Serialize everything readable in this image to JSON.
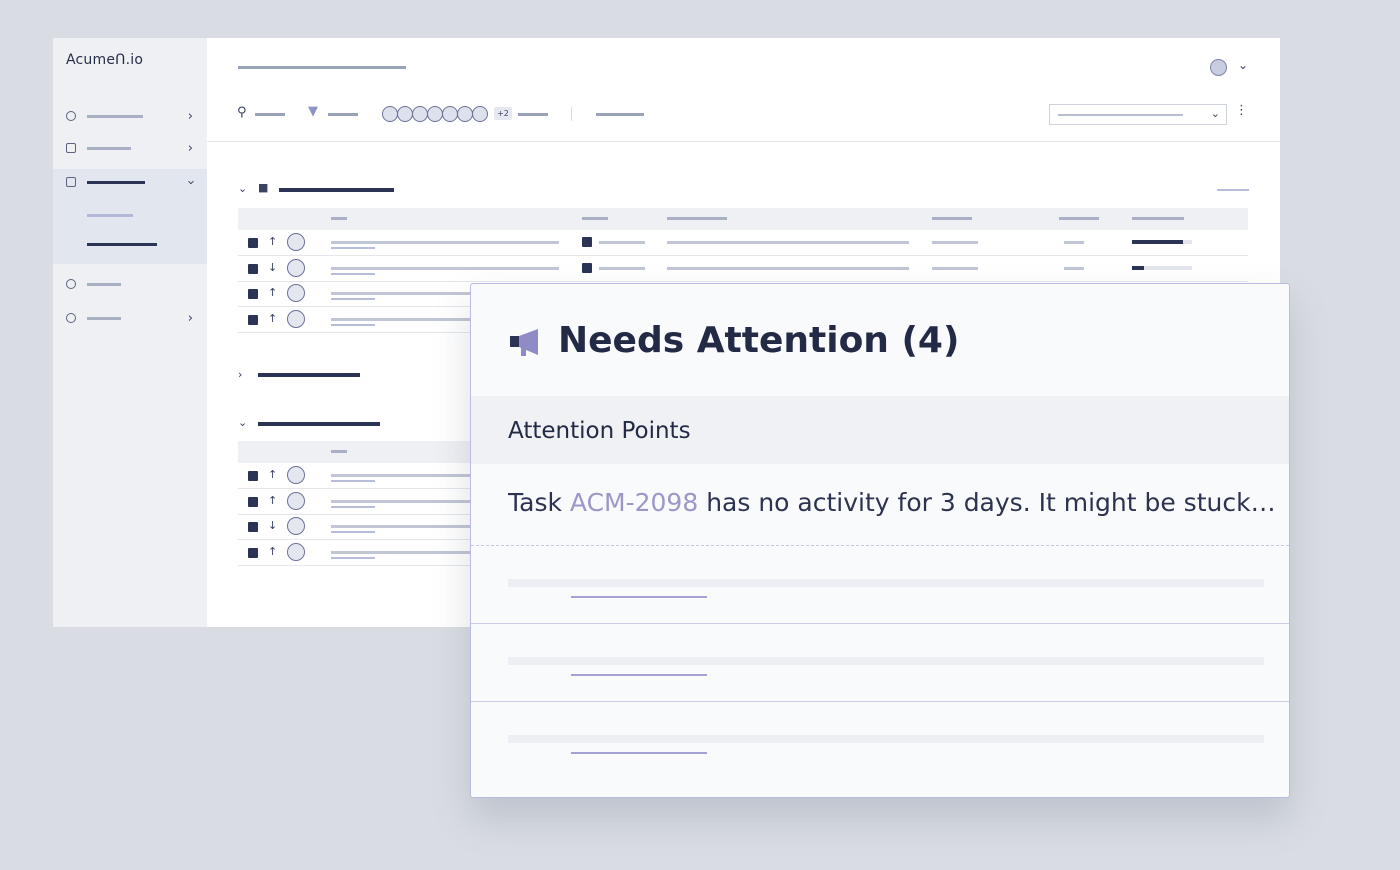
{
  "app": {
    "logo": "AcumeՈ.io"
  },
  "card": {
    "title": "Needs Attention (4)",
    "section_label": "Attention Points",
    "message": {
      "prefix": "Task ",
      "task_id": "ACM-2098",
      "suffix": " has no activity for 3 days. It might be stuck…"
    }
  },
  "toolbar": {
    "extra_assignees": "+2"
  },
  "tables": {
    "top_rows": [
      {
        "arrow": "↑",
        "progress": 0.85
      },
      {
        "arrow": "↓",
        "progress": 0.2
      },
      {
        "arrow": "↑",
        "progress": 0
      },
      {
        "arrow": "↑",
        "progress": 0
      }
    ],
    "bottom_rows": [
      {
        "arrow": "↑"
      },
      {
        "arrow": "↑"
      },
      {
        "arrow": "↓"
      },
      {
        "arrow": "↑"
      }
    ]
  },
  "colors": {
    "accent": "#2c3455",
    "link": "#9b97c9",
    "card_border": "#b9bce0"
  }
}
